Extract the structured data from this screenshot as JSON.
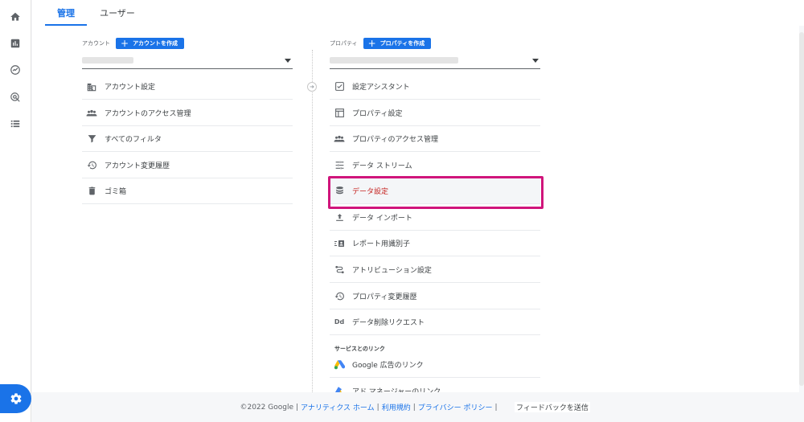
{
  "nav_rail": {
    "icons": [
      "home-icon",
      "reports-icon",
      "explore-icon",
      "advertising-icon",
      "configure-icon"
    ],
    "settings_icon": "gear-icon",
    "accent_color": "#1a73e8"
  },
  "tabs": [
    {
      "label": "管理",
      "active": true
    },
    {
      "label": "ユーザー",
      "active": false
    }
  ],
  "account": {
    "label": "アカウント",
    "create_button": "アカウントを作成",
    "items": [
      {
        "label": "アカウント設定",
        "icon": "building-icon"
      },
      {
        "label": "アカウントのアクセス管理",
        "icon": "people-icon"
      },
      {
        "label": "すべてのフィルタ",
        "icon": "filter-icon"
      },
      {
        "label": "アカウント変更履歴",
        "icon": "history-icon"
      },
      {
        "label": "ゴミ箱",
        "icon": "trash-icon"
      }
    ]
  },
  "property": {
    "label": "プロパティ",
    "create_button": "プロパティを作成",
    "items": [
      {
        "label": "設定アシスタント",
        "icon": "checkbox-icon"
      },
      {
        "label": "プロパティ設定",
        "icon": "layout-icon"
      },
      {
        "label": "プロパティのアクセス管理",
        "icon": "people-icon"
      },
      {
        "label": "データ ストリーム",
        "icon": "streams-icon"
      },
      {
        "label": "データ設定",
        "icon": "database-icon",
        "highlighted": true
      },
      {
        "label": "データ インポート",
        "icon": "upload-icon"
      },
      {
        "label": "レポート用識別子",
        "icon": "identity-icon"
      },
      {
        "label": "アトリビューション設定",
        "icon": "attribution-icon"
      },
      {
        "label": "プロパティ変更履歴",
        "icon": "history-icon"
      },
      {
        "label": "データ削除リクエスト",
        "icon": "dd-icon"
      }
    ],
    "section_title": "サービスとのリンク",
    "links": [
      {
        "label": "Google 広告のリンク",
        "icon": "google-ads-icon"
      },
      {
        "label": "アド マネージャーのリンク",
        "icon": "ad-manager-icon"
      }
    ],
    "highlight_color": "#d0157b"
  },
  "footer": {
    "copyright": "©2022 Google",
    "links": [
      "アナリティクス ホーム",
      "利用規約",
      "プライバシー ポリシー"
    ],
    "feedback": "フィードバックを送信"
  }
}
